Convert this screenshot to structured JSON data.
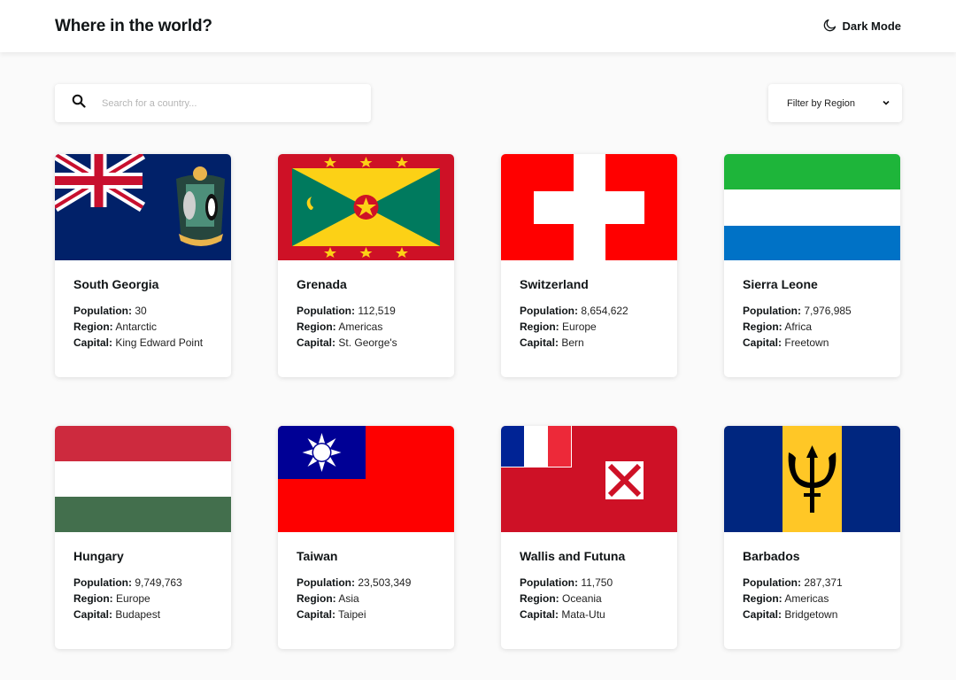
{
  "header": {
    "title": "Where in the world?",
    "mode_label": "Dark Mode",
    "mode_icon": "moon-icon"
  },
  "search": {
    "placeholder": "Search for a country...",
    "value": "",
    "icon": "search-icon"
  },
  "filter": {
    "label": "Filter by Region",
    "icon": "chevron-down-icon"
  },
  "labels": {
    "population": "Population:",
    "region": "Region:",
    "capital": "Capital:"
  },
  "countries": [
    {
      "name": "South Georgia",
      "population": "30",
      "region": "Antarctic",
      "capital": "King Edward Point"
    },
    {
      "name": "Grenada",
      "population": "112,519",
      "region": "Americas",
      "capital": "St. George's"
    },
    {
      "name": "Switzerland",
      "population": "8,654,622",
      "region": "Europe",
      "capital": "Bern"
    },
    {
      "name": "Sierra Leone",
      "population": "7,976,985",
      "region": "Africa",
      "capital": "Freetown"
    },
    {
      "name": "Hungary",
      "population": "9,749,763",
      "region": "Europe",
      "capital": "Budapest"
    },
    {
      "name": "Taiwan",
      "population": "23,503,349",
      "region": "Asia",
      "capital": "Taipei"
    },
    {
      "name": "Wallis and Futuna",
      "population": "11,750",
      "region": "Oceania",
      "capital": "Mata-Utu"
    },
    {
      "name": "Barbados",
      "population": "287,371",
      "region": "Americas",
      "capital": "Bridgetown"
    }
  ],
  "colors": {
    "background": "#fafafa",
    "surface": "#ffffff",
    "text": "#111517"
  }
}
